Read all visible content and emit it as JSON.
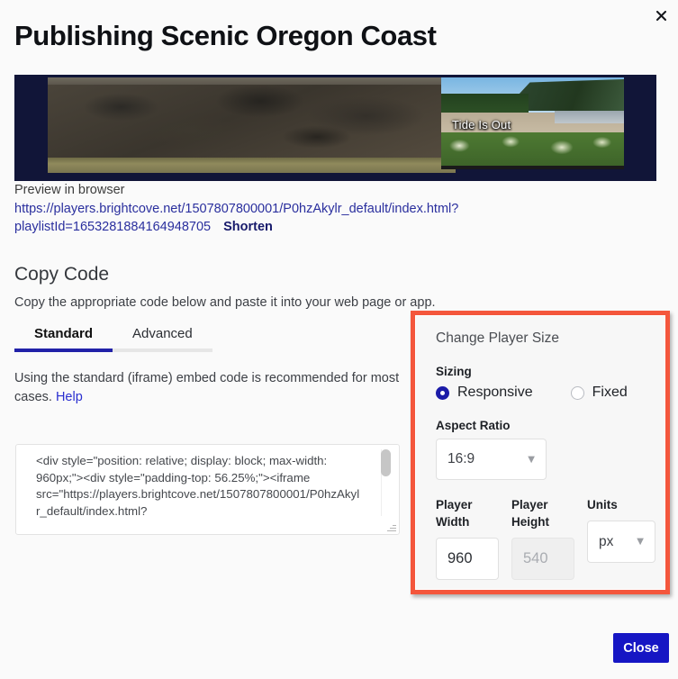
{
  "dialog": {
    "title": "Publishing Scenic Oregon Coast",
    "close_icon": "close-icon",
    "close_button_label": "Close"
  },
  "preview": {
    "video_caption": "Tide Is Out",
    "label": "Preview in browser",
    "url_line1": "https://players.brightcove.net/1507807800001/P0hzAkylr_default/index.html?",
    "url_line2": "playlistId=1653281884164948705",
    "shorten_label": "Shorten"
  },
  "copy_code": {
    "heading": "Copy Code",
    "subheading": "Copy the appropriate code below and paste it into your web page or app.",
    "tabs": [
      {
        "label": "Standard",
        "active": true
      },
      {
        "label": "Advanced",
        "active": false
      }
    ],
    "tab_description": "Using the standard (iframe) embed code is recommended for most cases.",
    "help_label": "Help",
    "code_snippet": "<div style=\"position: relative; display: block; max-width: 960px;\"><div style=\"padding-top: 56.25%;\"><iframe src=\"https://players.brightcove.net/1507807800001/P0hzAkylr_default/index.html?"
  },
  "player_size": {
    "panel_title": "Change Player Size",
    "sizing_label": "Sizing",
    "sizing_options": [
      {
        "label": "Responsive",
        "selected": true
      },
      {
        "label": "Fixed",
        "selected": false
      }
    ],
    "aspect_ratio_label": "Aspect Ratio",
    "aspect_ratio_value": "16:9",
    "player_width_label": "Player Width",
    "player_width_value": "960",
    "player_height_label": "Player Height",
    "player_height_value": "540",
    "units_label": "Units",
    "units_value": "px",
    "caret_icon": "chevron-down-icon"
  },
  "colors": {
    "highlight_border": "#f4563c",
    "accent_blue": "#1616c4",
    "tab_active_underline": "#2121a8",
    "link_blue": "#2a2f9e"
  }
}
